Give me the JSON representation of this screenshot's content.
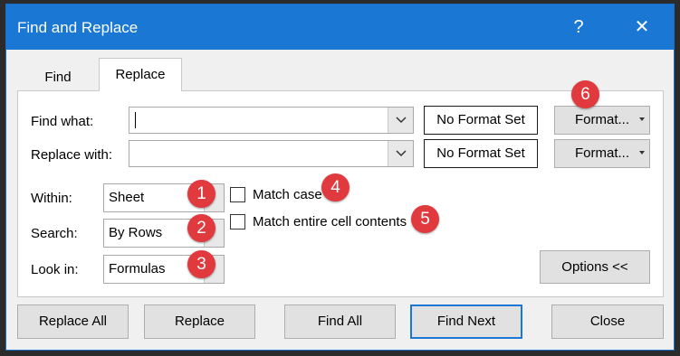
{
  "window": {
    "title": "Find and Replace",
    "help_label": "?",
    "close_label": "✕"
  },
  "tabs": {
    "find": "Find",
    "replace": "Replace"
  },
  "find_what": {
    "label": "Find what:",
    "value": "",
    "format_status": "No Format Set",
    "format_button": "Format..."
  },
  "replace_with": {
    "label": "Replace with:",
    "value": "",
    "format_status": "No Format Set",
    "format_button": "Format..."
  },
  "within": {
    "label": "Within:",
    "value": "Sheet"
  },
  "search": {
    "label": "Search:",
    "value": "By Rows"
  },
  "look_in": {
    "label": "Look in:",
    "value": "Formulas"
  },
  "options": {
    "match_case": "Match case",
    "match_case_checked": false,
    "match_entire": "Match entire cell contents",
    "match_entire_checked": false
  },
  "options_button": "Options <<",
  "annotations": [
    "1",
    "2",
    "3",
    "4",
    "5",
    "6"
  ],
  "buttons": {
    "replace_all": "Replace All",
    "replace": "Replace",
    "find_all": "Find All",
    "find_next": "Find Next",
    "close": "Close"
  },
  "colors": {
    "titlebar": "#1a77d4",
    "badge": "#e0393e",
    "default_button_border": "#1a77d4"
  }
}
